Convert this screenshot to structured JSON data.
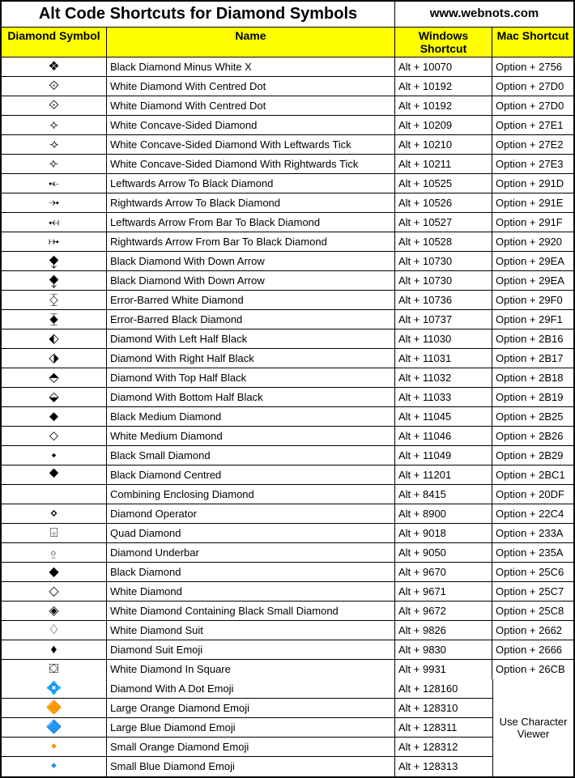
{
  "title": "Alt Code Shortcuts for Diamond Symbols",
  "url": "www.webnots.com",
  "headers": {
    "symbol": "Diamond Symbol",
    "name": "Name",
    "win": "Windows Shortcut",
    "mac": "Mac Shortcut"
  },
  "merged_mac_text": "Use Character Viewer",
  "rows": [
    {
      "symbol": "❖",
      "name": "Black Diamond Minus White X",
      "win": "Alt + 10070",
      "mac": "Option + 2756"
    },
    {
      "symbol": "⟐",
      "name": "White Diamond With Centred Dot",
      "win": "Alt + 10192",
      "mac": "Option + 27D0"
    },
    {
      "symbol": "⟐",
      "name": "White Diamond With Centred Dot",
      "win": "Alt + 10192",
      "mac": "Option + 27D0"
    },
    {
      "symbol": "⟡",
      "name": "White Concave-Sided Diamond",
      "win": "Alt + 10209",
      "mac": "Option + 27E1"
    },
    {
      "symbol": "⟢",
      "name": "White Concave-Sided Diamond With Leftwards Tick",
      "win": "Alt + 10210",
      "mac": "Option + 27E2"
    },
    {
      "symbol": "⟣",
      "name": "White Concave-Sided Diamond With Rightwards Tick",
      "win": "Alt + 10211",
      "mac": "Option + 27E3"
    },
    {
      "symbol": "⤝",
      "name": "Leftwards Arrow To Black Diamond",
      "win": "Alt + 10525",
      "mac": "Option + 291D"
    },
    {
      "symbol": "⤞",
      "name": "Rightwards Arrow To Black Diamond",
      "win": "Alt + 10526",
      "mac": "Option + 291E"
    },
    {
      "symbol": "⤟",
      "name": "Leftwards Arrow From Bar To Black Diamond",
      "win": "Alt + 10527",
      "mac": "Option + 291F"
    },
    {
      "symbol": "⤠",
      "name": "Rightwards Arrow From Bar To Black Diamond",
      "win": "Alt + 10528",
      "mac": "Option + 2920"
    },
    {
      "symbol": "⧪",
      "name": "Black Diamond With Down Arrow",
      "win": "Alt + 10730",
      "mac": "Option + 29EA"
    },
    {
      "symbol": "⧪",
      "name": "Black Diamond With Down Arrow",
      "win": "Alt + 10730",
      "mac": "Option + 29EA"
    },
    {
      "symbol": "⧰",
      "name": "Error-Barred White Diamond",
      "win": "Alt + 10736",
      "mac": "Option + 29F0"
    },
    {
      "symbol": "⧱",
      "name": "Error-Barred Black Diamond",
      "win": "Alt + 10737",
      "mac": "Option + 29F1"
    },
    {
      "symbol": "⬖",
      "name": "Diamond With Left Half Black",
      "win": "Alt + 11030",
      "mac": "Option + 2B16"
    },
    {
      "symbol": "⬗",
      "name": "Diamond With Right Half Black",
      "win": "Alt + 11031",
      "mac": "Option + 2B17"
    },
    {
      "symbol": "⬘",
      "name": "Diamond With Top Half Black",
      "win": "Alt + 11032",
      "mac": "Option + 2B18"
    },
    {
      "symbol": "⬙",
      "name": "Diamond With Bottom Half Black",
      "win": "Alt + 11033",
      "mac": "Option + 2B19"
    },
    {
      "symbol": "⬥",
      "name": "Black Medium Diamond",
      "win": "Alt + 11045",
      "mac": "Option + 2B25"
    },
    {
      "symbol": "⬦",
      "name": "White Medium Diamond",
      "win": "Alt + 11046",
      "mac": "Option + 2B26"
    },
    {
      "symbol": "⬩",
      "name": "Black Small Diamond",
      "win": "Alt + 11049",
      "mac": "Option + 2B29"
    },
    {
      "symbol": "⯁",
      "name": "Black Diamond Centred",
      "win": "Alt + 11201",
      "mac": "Option + 2BC1"
    },
    {
      "symbol": " ",
      "name": "Combining Enclosing Diamond",
      "win": "Alt + 8415",
      "mac": "Option + 20DF"
    },
    {
      "symbol": "⋄",
      "name": "Diamond Operator",
      "win": "Alt + 8900",
      "mac": "Option + 22C4"
    },
    {
      "symbol": "⌺",
      "name": "Quad Diamond",
      "win": "Alt + 9018",
      "mac": "Option + 233A"
    },
    {
      "symbol": "⍚",
      "name": "Diamond Underbar",
      "win": "Alt + 9050",
      "mac": "Option + 235A"
    },
    {
      "symbol": "◆",
      "name": "Black Diamond",
      "win": "Alt + 9670",
      "mac": "Option + 25C6"
    },
    {
      "symbol": "◇",
      "name": "White Diamond",
      "win": "Alt + 9671",
      "mac": "Option + 25C7"
    },
    {
      "symbol": "◈",
      "name": "White Diamond Containing Black Small Diamond",
      "win": "Alt + 9672",
      "mac": "Option + 25C8"
    },
    {
      "symbol": "♢",
      "name": "White Diamond Suit",
      "win": "Alt + 9826",
      "mac": "Option + 2662"
    },
    {
      "symbol": "♦",
      "name": "Diamond Suit Emoji",
      "win": "Alt + 9830",
      "mac": "Option + 2666"
    },
    {
      "symbol": "⛋",
      "name": "White Diamond In Square",
      "win": "Alt + 9931",
      "mac": "Option + 26CB"
    }
  ],
  "bottom_rows": [
    {
      "symbol": "💠",
      "name": "Diamond With A Dot Emoji",
      "win": "Alt + 128160"
    },
    {
      "symbol": "🔶",
      "name": "Large Orange Diamond Emoji",
      "win": "Alt + 128310"
    },
    {
      "symbol": "🔷",
      "name": "Large Blue Diamond Emoji",
      "win": "Alt + 128311"
    },
    {
      "symbol": "🔸",
      "name": "Small Orange Diamond Emoji",
      "win": "Alt + 128312"
    },
    {
      "symbol": "🔹",
      "name": "Small Blue Diamond Emoji",
      "win": "Alt + 128313"
    }
  ]
}
